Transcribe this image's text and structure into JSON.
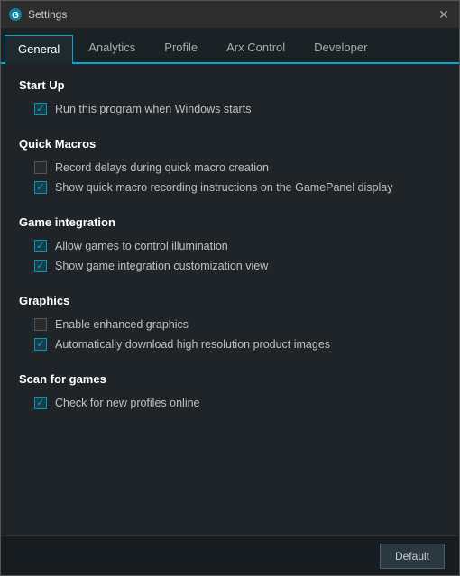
{
  "window": {
    "title": "Settings",
    "close_label": "✕"
  },
  "tabs": [
    {
      "id": "general",
      "label": "General",
      "active": true
    },
    {
      "id": "analytics",
      "label": "Analytics",
      "active": false
    },
    {
      "id": "profile",
      "label": "Profile",
      "active": false
    },
    {
      "id": "arx-control",
      "label": "Arx Control",
      "active": false
    },
    {
      "id": "developer",
      "label": "Developer",
      "active": false
    }
  ],
  "sections": [
    {
      "id": "startup",
      "title": "Start Up",
      "items": [
        {
          "id": "startup-1",
          "checked": true,
          "label": "Run this program when Windows starts"
        }
      ]
    },
    {
      "id": "quick-macros",
      "title": "Quick Macros",
      "items": [
        {
          "id": "qm-1",
          "checked": false,
          "label": "Record delays during quick macro creation"
        },
        {
          "id": "qm-2",
          "checked": true,
          "label": "Show quick macro recording instructions on the GamePanel display"
        }
      ]
    },
    {
      "id": "game-integration",
      "title": "Game integration",
      "items": [
        {
          "id": "gi-1",
          "checked": true,
          "label": "Allow games to control illumination"
        },
        {
          "id": "gi-2",
          "checked": true,
          "label": "Show game integration customization view"
        }
      ]
    },
    {
      "id": "graphics",
      "title": "Graphics",
      "items": [
        {
          "id": "gr-1",
          "checked": false,
          "label": "Enable enhanced graphics"
        },
        {
          "id": "gr-2",
          "checked": true,
          "label": "Automatically download high resolution product images"
        }
      ]
    },
    {
      "id": "scan-for-games",
      "title": "Scan for games",
      "items": [
        {
          "id": "sg-1",
          "checked": true,
          "label": "Check for new profiles online"
        }
      ]
    }
  ],
  "footer": {
    "default_button_label": "Default"
  }
}
